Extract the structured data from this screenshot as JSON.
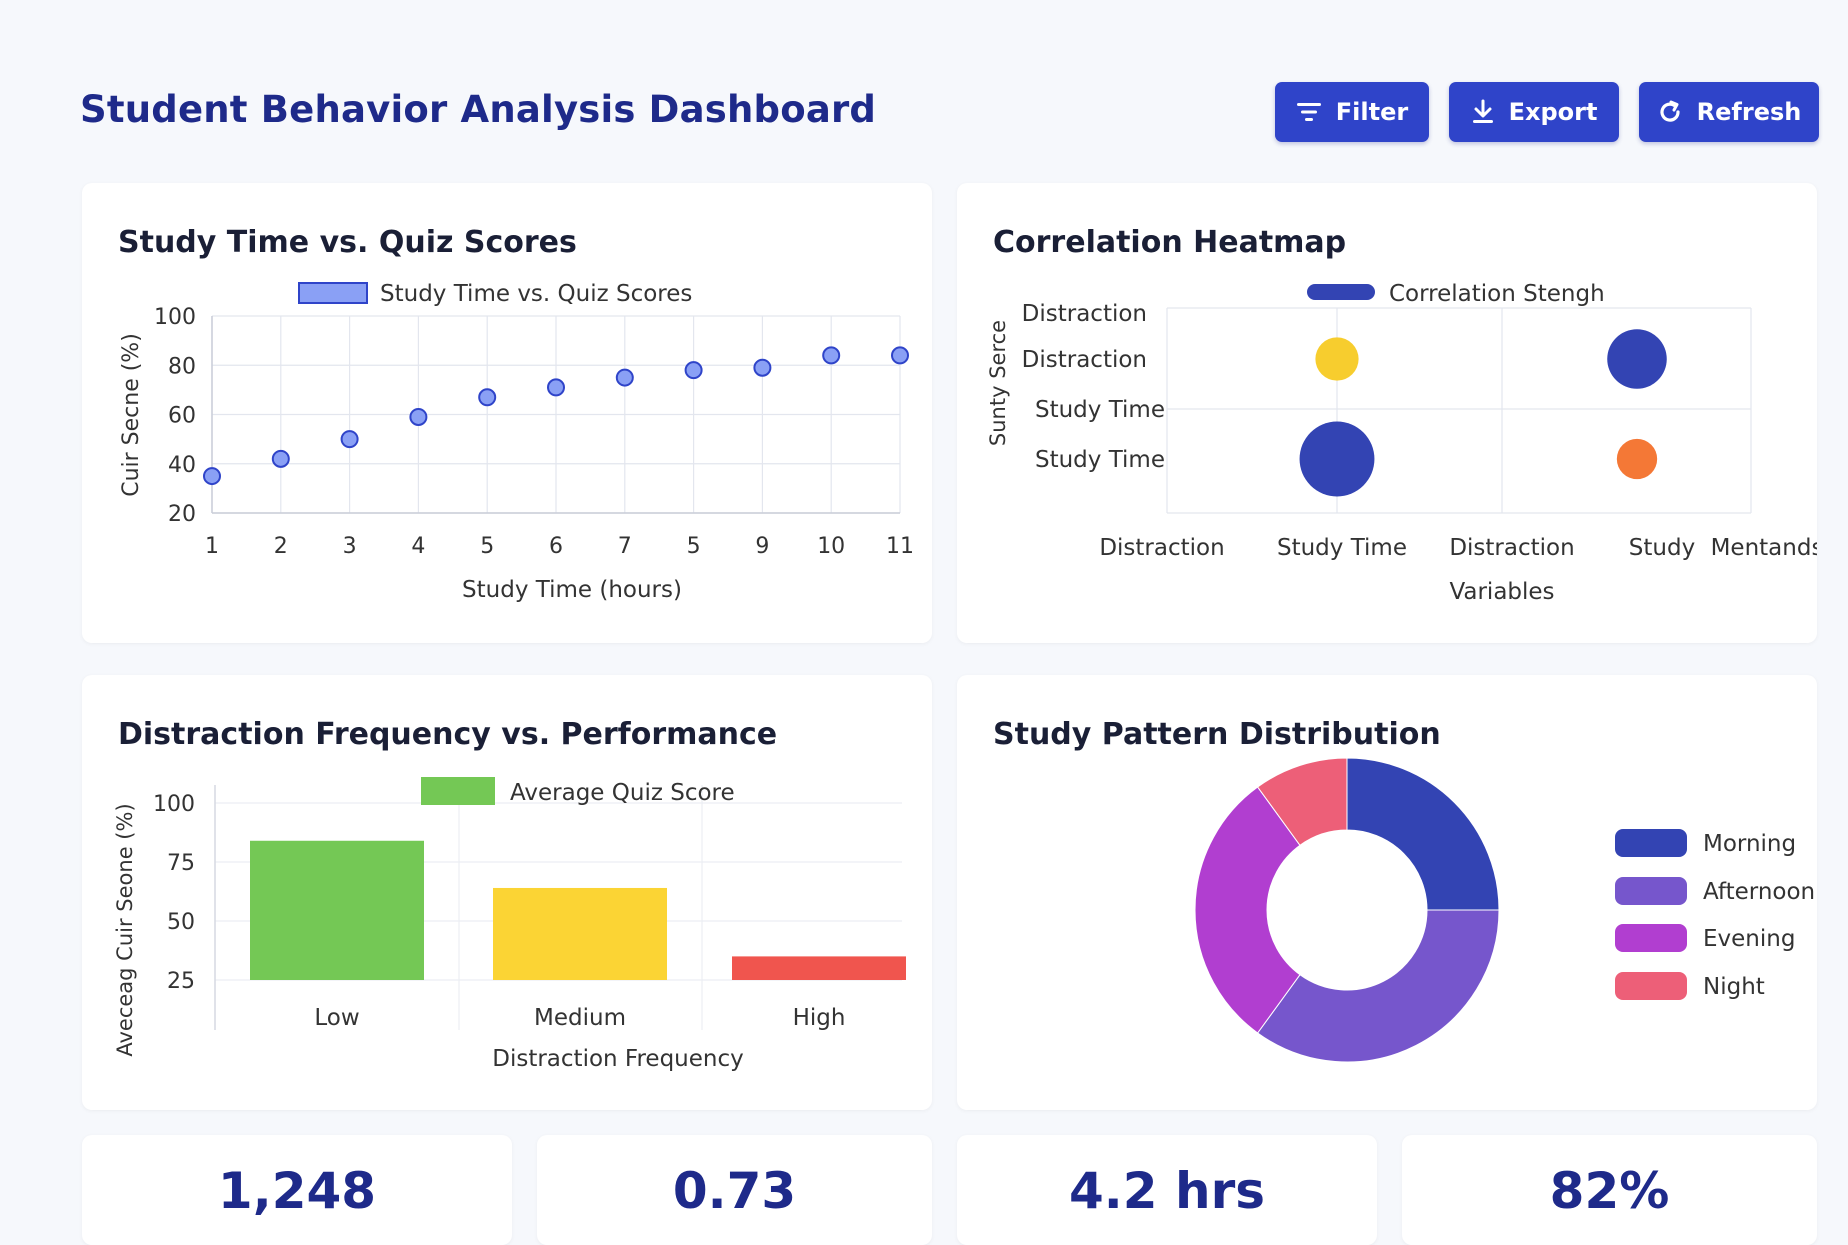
{
  "header": {
    "title": "Student Behavior Analysis Dashboard",
    "buttons": {
      "filter": "Filter",
      "export": "Export",
      "refresh": "Refresh"
    },
    "button_color": "#2f44c9"
  },
  "cards": {
    "scatter_title": "Study Time vs. Quiz Scores",
    "heatmap_title": "Correlation Heatmap",
    "bar_title": "Distraction Frequency vs. Performance",
    "donut_title": "Study Pattern Distribution"
  },
  "chart_data": [
    {
      "type": "scatter",
      "legend": "Study Time vs. Quiz Scores",
      "xlabel": "Study Time (hours)",
      "ylabel": "Cuir Secne (%)",
      "x_tick_labels": [
        "1",
        "2",
        "3",
        "4",
        "5",
        "6",
        "7",
        "5",
        "9",
        "10",
        "11"
      ],
      "y_ticks": [
        20,
        40,
        60,
        80,
        100
      ],
      "ylim": [
        20,
        100
      ],
      "points": [
        {
          "x": 1,
          "y": 35
        },
        {
          "x": 2,
          "y": 42
        },
        {
          "x": 3,
          "y": 50
        },
        {
          "x": 4,
          "y": 59
        },
        {
          "x": 5,
          "y": 67
        },
        {
          "x": 6,
          "y": 71
        },
        {
          "x": 7,
          "y": 75
        },
        {
          "x": 8,
          "y": 78
        },
        {
          "x": 9,
          "y": 79
        },
        {
          "x": 10,
          "y": 84
        },
        {
          "x": 11,
          "y": 84
        }
      ],
      "color": "#8aa0f5",
      "edge_color": "#2f44c9",
      "grid": true,
      "legend_position": "top-center"
    },
    {
      "type": "bubble",
      "legend": "Correlation Stengh",
      "ylabel": "Sunty Serce",
      "xlabel": "Variables",
      "y_labels": [
        "Distraction",
        "Distraction",
        "Study Time",
        "Study Time"
      ],
      "x_labels": [
        "Distraction",
        "Study Time",
        "Distraction",
        "Study",
        "Mentands"
      ],
      "bubbles": [
        {
          "col": 1,
          "row": 1,
          "size": 0.45,
          "color": "#f7cd2e"
        },
        {
          "col": 3,
          "row": 1,
          "size": 0.62,
          "color": "#3344b3"
        },
        {
          "col": 1,
          "row": 3,
          "size": 0.78,
          "color": "#3344b3"
        },
        {
          "col": 3,
          "row": 3,
          "size": 0.42,
          "color": "#f47836"
        }
      ],
      "grid": true,
      "legend_position": "top-center"
    },
    {
      "type": "bar",
      "legend": "Average Quiz Score",
      "xlabel": "Distraction Frequency",
      "ylabel": "Aveceag Cuir Seone (%)",
      "categories": [
        "Low",
        "Medium",
        "High"
      ],
      "values": [
        84,
        64,
        35
      ],
      "colors": [
        "#74c855",
        "#fbd434",
        "#f0554e"
      ],
      "y_ticks": [
        25,
        50,
        75,
        100
      ],
      "ylim": [
        25,
        100
      ],
      "legend_color": "#74c855",
      "legend_position": "top-center"
    },
    {
      "type": "pie",
      "donut": true,
      "categories": [
        "Morning",
        "Afternoon",
        "Evening",
        "Night"
      ],
      "values": [
        25,
        35,
        30,
        10
      ],
      "colors": [
        "#3344b3",
        "#7656cc",
        "#b13ed0",
        "#ed5f78"
      ],
      "legend_position": "right"
    }
  ],
  "stats": {
    "stat1": "1,248",
    "stat2": "0.73",
    "stat3": "4.2 hrs",
    "stat4": "82%"
  }
}
